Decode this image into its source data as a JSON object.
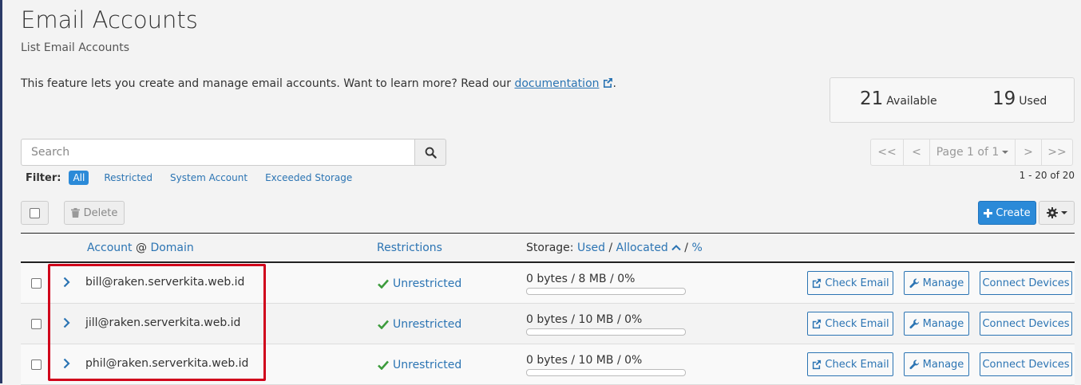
{
  "header": {
    "title": "Email Accounts",
    "subtitle": "List Email Accounts",
    "intro_text": "This feature lets you create and manage email accounts. Want to learn more? Read our ",
    "intro_link": "documentation",
    "intro_suffix": "."
  },
  "stats": {
    "available_count": "21",
    "available_label": "Available",
    "used_count": "19",
    "used_label": "Used"
  },
  "search": {
    "placeholder": "Search"
  },
  "pagination": {
    "first": "<<",
    "prev": "<",
    "page_label": "Page 1 of 1",
    "next": ">",
    "last": ">>",
    "range": "1 - 20 of 20"
  },
  "filter": {
    "label": "Filter:",
    "options": [
      "All",
      "Restricted",
      "System Account",
      "Exceeded Storage"
    ]
  },
  "toolbar": {
    "delete_label": "Delete",
    "create_label": "Create"
  },
  "table": {
    "headers": {
      "account": "Account",
      "at": "@",
      "domain": "Domain",
      "restrictions": "Restrictions",
      "storage_prefix": "Storage:",
      "used": "Used",
      "sep1": "/",
      "allocated": "Allocated",
      "sep2": "/",
      "percent": "%"
    },
    "rows": [
      {
        "account": "bill@raken.serverkita.web.id",
        "restriction": "Unrestricted",
        "storage": "0 bytes / 8 MB / 0%",
        "usage_percent": 0,
        "check_email": "Check Email",
        "manage": "Manage",
        "connect": "Connect Devices"
      },
      {
        "account": "jill@raken.serverkita.web.id",
        "restriction": "Unrestricted",
        "storage": "0 bytes / 10 MB / 0%",
        "usage_percent": 0,
        "check_email": "Check Email",
        "manage": "Manage",
        "connect": "Connect Devices"
      },
      {
        "account": "phil@raken.serverkita.web.id",
        "restriction": "Unrestricted",
        "storage": "0 bytes / 10 MB / 0%",
        "usage_percent": 0,
        "check_email": "Check Email",
        "manage": "Manage",
        "connect": "Connect Devices"
      }
    ]
  },
  "colors": {
    "accent": "#2b8ad8",
    "link": "#2b74b3",
    "success": "#3c9b3c",
    "highlight": "#d0021b"
  }
}
